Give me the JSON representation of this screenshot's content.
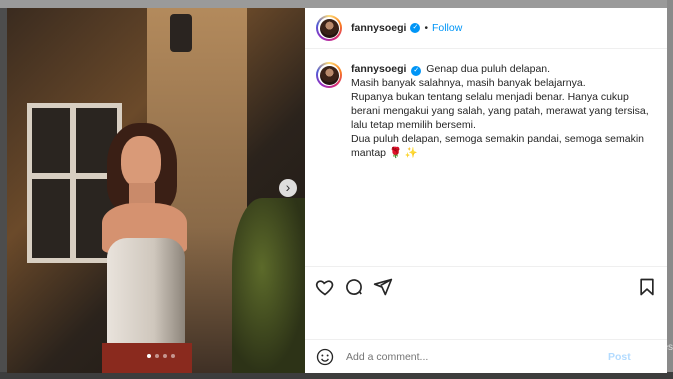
{
  "post": {
    "username": "fannysoegi",
    "separator": "•",
    "follow_label": "Follow",
    "verified_mark": "✓",
    "caption_lines": [
      "Genap dua puluh delapan.",
      "Masih banyak salahnya, masih banyak belajarnya.",
      "Rupanya bukan tentang selalu menjadi benar. Hanya cukup berani mengakui yang salah, yang patah, merawat yang tersisa, lalu tetap memilih bersemi.",
      "Dua puluh delapan, semoga semakin pandai, semoga semakin mantap 🌹 ✨"
    ]
  },
  "media": {
    "next_icon": "›",
    "carousel_count": 4,
    "carousel_active_index": 0
  },
  "comment": {
    "placeholder": "Add a comment...",
    "post_label": "Post"
  },
  "background": {
    "edge_text": "es"
  },
  "icons": {
    "like": "heart-icon",
    "comment": "comment-icon",
    "share": "share-icon",
    "save": "bookmark-icon",
    "emoji": "smiley-icon"
  },
  "colors": {
    "accent": "#0095f6",
    "post_disabled": "#b3dbff"
  }
}
